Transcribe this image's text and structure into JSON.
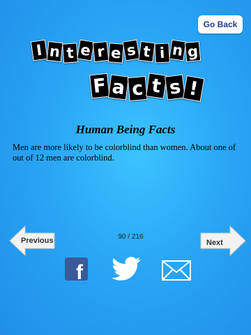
{
  "header": {
    "go_back_label": "Go Back"
  },
  "logo": {
    "line1": [
      "I",
      "n",
      "t",
      "e",
      "r",
      "e",
      "s",
      "t",
      "i",
      "n",
      "g"
    ],
    "line2": [
      "F",
      "a",
      "c",
      "t",
      "s",
      "!"
    ]
  },
  "content": {
    "section_title": "Human Being Facts",
    "fact_text": "Men are more likely to be colorblind than women. About one of out of 12 men are colorblind."
  },
  "navigation": {
    "previous_label": "Previous",
    "next_label": "Next",
    "counter": "90 / 216"
  },
  "share": {
    "facebook_glyph": "f",
    "icons": [
      "facebook-icon",
      "twitter-icon",
      "mail-icon"
    ]
  },
  "colors": {
    "background": "#2aa6f5",
    "facebook": "#3b5998"
  }
}
